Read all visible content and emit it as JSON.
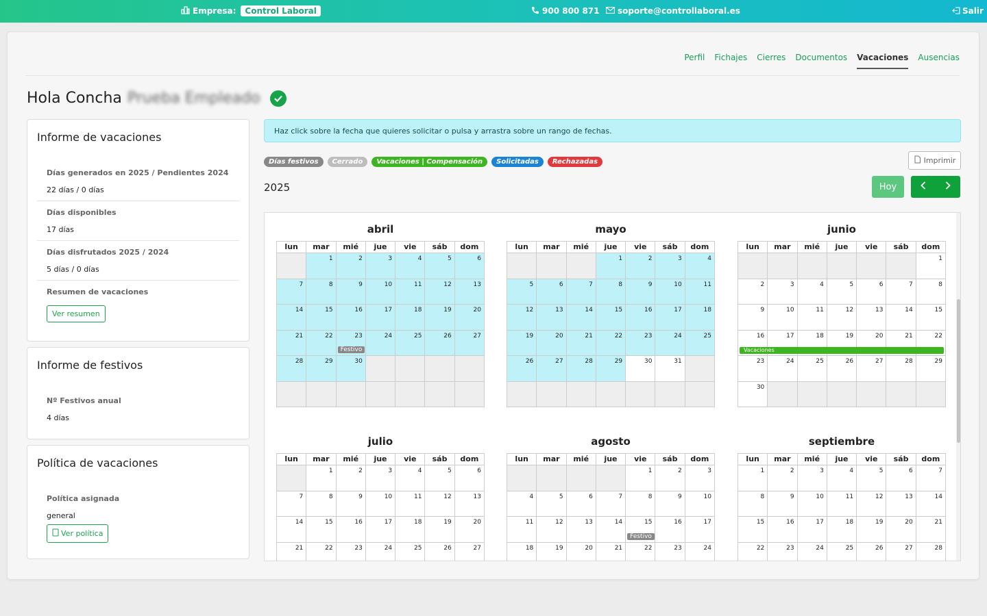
{
  "topbar": {
    "company_label": "Empresa:",
    "company_name": "Control Laboral",
    "phone": "900 800 871",
    "email": "soporte@controllaboral.es",
    "logout": "Salir"
  },
  "nav": {
    "items": [
      {
        "label": "Perfil"
      },
      {
        "label": "Fichajes"
      },
      {
        "label": "Cierres"
      },
      {
        "label": "Documentos"
      },
      {
        "label": "Vacaciones"
      },
      {
        "label": "Ausencias"
      }
    ],
    "active": "Vacaciones"
  },
  "greeting": {
    "prefix": "Hola Concha",
    "surname": "Prueba Empleado"
  },
  "vacation_report": {
    "title": "Informe de vacaciones",
    "generated_label": "Días generados en 2025 / Pendientes 2024",
    "generated_value": "22 días / 0 días",
    "available_label": "Días disponibles",
    "available_value": "17 días",
    "enjoyed_label": "Días disfrutados 2025 / 2024",
    "enjoyed_value": "5 días / 0 días",
    "summary_label": "Resumen de vacaciones",
    "summary_button": "Ver resumen"
  },
  "holiday_report": {
    "title": "Informe de festivos",
    "count_label": "Nº Festivos anual",
    "count_value": "4 días"
  },
  "policy": {
    "title": "Política de vacaciones",
    "assigned_label": "Política asignada",
    "assigned_value": "general",
    "button": "Ver política"
  },
  "alert": "Haz click sobre la fecha que quieres solicitar o pulsa y arrastra sobre un rango de fechas.",
  "legend": [
    {
      "label": "Días festivos",
      "color": "#888888"
    },
    {
      "label": "Cerrado",
      "color": "#bdbdbd"
    },
    {
      "label": "Vacaciones | Compensación",
      "color": "#3db520"
    },
    {
      "label": "Solicitadas",
      "color": "#1a83d6"
    },
    {
      "label": "Rechazadas",
      "color": "#e0393e"
    }
  ],
  "toolbar": {
    "print": "Imprimir",
    "today": "Hoy",
    "year": "2025"
  },
  "weekdays": [
    "lun",
    "mar",
    "mié",
    "jue",
    "vie",
    "sáb",
    "dom"
  ],
  "festivo_label": "Festivo",
  "vacation_label": "Vacaciones",
  "months": [
    {
      "name": "abril"
    },
    {
      "name": "mayo"
    },
    {
      "name": "junio"
    },
    {
      "name": "julio"
    },
    {
      "name": "agosto"
    },
    {
      "name": "septiembre"
    }
  ],
  "colors": {
    "accent": "#1aa54d",
    "selected_day": "#bff1f8",
    "outside_day": "#eeeeef"
  }
}
